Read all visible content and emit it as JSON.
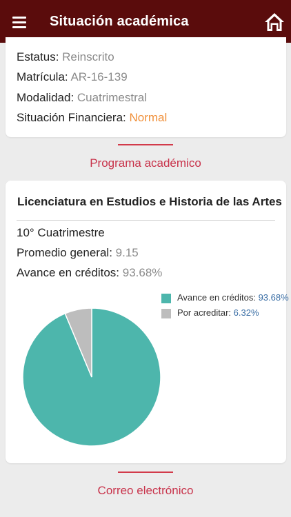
{
  "header": {
    "title": "Situación académica",
    "menu_icon": "hamburger-menu-icon",
    "home_icon": "home-icon"
  },
  "student": {
    "status_label": "Estatus:",
    "status_value": "Reinscrito",
    "id_label": "Matrícula:",
    "id_value": "AR-16-139",
    "mode_label": "Modalidad:",
    "mode_value": "Cuatrimestral",
    "finance_label": "Situación Financiera:",
    "finance_value": "Normal"
  },
  "program_section_label": "Programa académico",
  "program": {
    "name": "Licenciatura en Estudios e Historia de las Artes",
    "term": "10° Cuatrimestre",
    "gpa_label": "Promedio general:",
    "gpa_value": "9.15",
    "progress_label": "Avance en créditos:",
    "progress_value": "93.68%"
  },
  "chart_data": {
    "type": "pie",
    "slices": [
      {
        "label": "Avance en créditos:",
        "value": 93.68,
        "display": "93.68%",
        "color": "#4db6ac"
      },
      {
        "label": "Por acreditar:",
        "value": 6.32,
        "display": "6.32%",
        "color": "#bdbdbd"
      }
    ]
  },
  "email_section_label": "Correo electrónico",
  "colors": {
    "header_bg": "#5a0c0c",
    "accent_red": "#c8324a",
    "financial_status": "#f0903a",
    "progress_slice": "#4db6ac",
    "pending_slice": "#bdbdbd"
  }
}
